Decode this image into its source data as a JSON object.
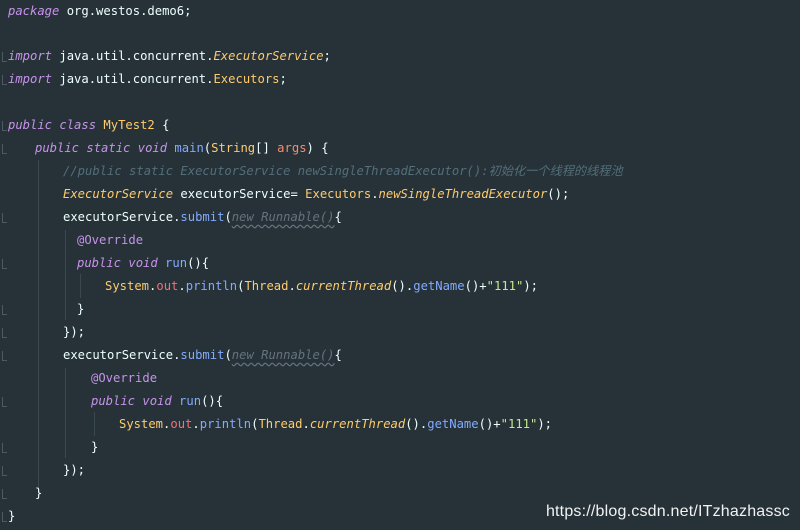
{
  "code": {
    "l1": {
      "kw": "package",
      "rest": " org.westos.demo6",
      "semi": ";"
    },
    "l2": {
      "kw": "import",
      "pkg": " java.util.concurrent.",
      "cls": "ExecutorService",
      "semi": ";"
    },
    "l3": {
      "kw": "import",
      "pkg": " java.util.concurrent.",
      "cls": "Executors",
      "semi": ";"
    },
    "l4": {
      "kw1": "public",
      "kw2": " class",
      "name": " MyTest2",
      "brace": " {"
    },
    "l5": {
      "kw1": "public",
      "kw2": " static",
      "kw3": " void",
      "fn": " main",
      "open": "(",
      "type": "String",
      "arr": "[]",
      "param": " args",
      "close": ")",
      "brace": " {"
    },
    "l6": {
      "comment": "//public static ExecutorService newSingleThreadExecutor():初始化一个线程的线程池"
    },
    "l7": {
      "cls": "ExecutorService",
      "var": " executorService",
      "eq": "=",
      "cls2": " Executors",
      "dot": ".",
      "fn": "newSingleThreadExecutor",
      "tail": "();"
    },
    "l8": {
      "var": "executorService",
      "dot": ".",
      "fn": "submit",
      "open": "(",
      "dim": "new Runnable()",
      "brace": "{"
    },
    "l9": {
      "ann": "@Override"
    },
    "l10": {
      "kw1": "public",
      "kw2": " void",
      "fn": " run",
      "tail": "(){"
    },
    "l11": {
      "cls": "System",
      "dot1": ".",
      "field": "out",
      "dot2": ".",
      "fn": "println",
      "open": "(",
      "cls2": "Thread",
      "dot3": ".",
      "fn2": "currentThread",
      "p": "()",
      "dot4": ".",
      "fn3": "getName",
      "p2": "()+",
      "str": "\"111\"",
      "close": ");"
    },
    "l12": {
      "brace": "}"
    },
    "l13": {
      "close": "});"
    },
    "l14": {
      "var": "executorService",
      "dot": ".",
      "fn": "submit",
      "open": "(",
      "dim": "new Runnable()",
      "brace": "{"
    },
    "l15": {
      "ann": "@Override"
    },
    "l16": {
      "kw1": "public",
      "kw2": " void",
      "fn": " run",
      "tail": "(){"
    },
    "l17": {
      "cls": "System",
      "dot1": ".",
      "field": "out",
      "dot2": ".",
      "fn": "println",
      "open": "(",
      "cls2": "Thread",
      "dot3": ".",
      "fn2": "currentThread",
      "p": "()",
      "dot4": ".",
      "fn3": "getName",
      "p2": "()+",
      "str": "\"111\"",
      "close": ");"
    },
    "l18": {
      "brace": "}"
    },
    "l19": {
      "close": "});"
    },
    "l20": {
      "brace": "}"
    },
    "l21": {
      "brace": "}"
    }
  },
  "watermark": "https://blog.csdn.net/ITzhazhassc",
  "colors": {
    "background": "#263238",
    "keyword": "#C792EA",
    "class": "#FFCB6B",
    "function": "#82AAFF",
    "parameter": "#F78C6C",
    "field": "#F07178",
    "string": "#C3E88D",
    "comment": "#546E7A",
    "punctuation": "#89DDFF"
  }
}
